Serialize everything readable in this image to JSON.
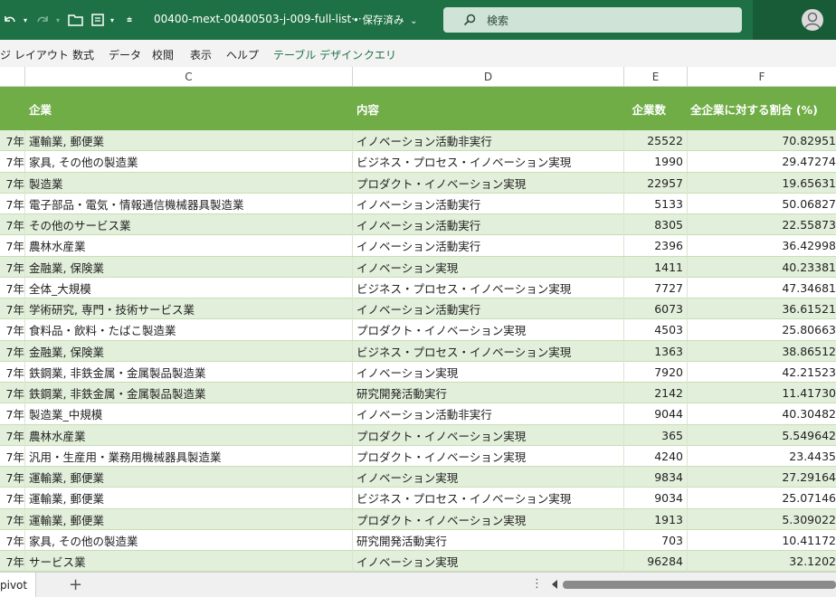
{
  "titlebar": {
    "document_name": "00400-mext-00400503-j-009-full-list···",
    "save_status": "• 保存済み",
    "search_placeholder": "検索"
  },
  "ribbon": {
    "tabs": [
      "ジ レイアウト",
      "数式",
      "データ",
      "校閲",
      "表示",
      "ヘルプ",
      "テーブル デザイン",
      "クエリ"
    ]
  },
  "columns": [
    "C",
    "D",
    "E",
    "F"
  ],
  "table": {
    "headers": {
      "company": "企業",
      "content": "内容",
      "count": "企業数",
      "ratio": "全企業に対する割合 (%)"
    },
    "rows": [
      {
        "year": "7年",
        "company": "運輸業, 郵便業",
        "content": "イノベーション活動非実行",
        "count": "25522",
        "ratio": "70.82951"
      },
      {
        "year": "7年",
        "company": "家具, その他の製造業",
        "content": "ビジネス・プロセス・イノベーション実現",
        "count": "1990",
        "ratio": "29.47274"
      },
      {
        "year": "7年",
        "company": "製造業",
        "content": "プロダクト・イノベーション実現",
        "count": "22957",
        "ratio": "19.65631"
      },
      {
        "year": "7年",
        "company": "電子部品・電気・情報通信機械器具製造業",
        "content": "イノベーション活動実行",
        "count": "5133",
        "ratio": "50.06827"
      },
      {
        "year": "7年",
        "company": "その他のサービス業",
        "content": "イノベーション活動実行",
        "count": "8305",
        "ratio": "22.55873"
      },
      {
        "year": "7年",
        "company": "農林水産業",
        "content": "イノベーション活動実行",
        "count": "2396",
        "ratio": "36.42998"
      },
      {
        "year": "7年",
        "company": "金融業, 保険業",
        "content": "イノベーション実現",
        "count": "1411",
        "ratio": "40.23381"
      },
      {
        "year": "7年",
        "company": "全体_大規模",
        "content": "ビジネス・プロセス・イノベーション実現",
        "count": "7727",
        "ratio": "47.34681"
      },
      {
        "year": "7年",
        "company": "学術研究, 専門・技術サービス業",
        "content": "イノベーション活動実行",
        "count": "6073",
        "ratio": "36.61521"
      },
      {
        "year": "7年",
        "company": "食料品・飲料・たばこ製造業",
        "content": "プロダクト・イノベーション実現",
        "count": "4503",
        "ratio": "25.80663"
      },
      {
        "year": "7年",
        "company": "金融業, 保険業",
        "content": "ビジネス・プロセス・イノベーション実現",
        "count": "1363",
        "ratio": "38.86512"
      },
      {
        "year": "7年",
        "company": "鉄鋼業, 非鉄金属・金属製品製造業",
        "content": "イノベーション実現",
        "count": "7920",
        "ratio": "42.21523"
      },
      {
        "year": "7年",
        "company": "鉄鋼業, 非鉄金属・金属製品製造業",
        "content": "研究開発活動実行",
        "count": "2142",
        "ratio": "11.41730"
      },
      {
        "year": "7年",
        "company": "製造業_中規模",
        "content": "イノベーション活動非実行",
        "count": "9044",
        "ratio": "40.30482"
      },
      {
        "year": "7年",
        "company": "農林水産業",
        "content": "プロダクト・イノベーション実現",
        "count": "365",
        "ratio": "5.549642"
      },
      {
        "year": "7年",
        "company": "汎用・生産用・業務用機械器具製造業",
        "content": "プロダクト・イノベーション実現",
        "count": "4240",
        "ratio": "23.4435"
      },
      {
        "year": "7年",
        "company": "運輸業, 郵便業",
        "content": "イノベーション実現",
        "count": "9834",
        "ratio": "27.29164"
      },
      {
        "year": "7年",
        "company": "運輸業, 郵便業",
        "content": "ビジネス・プロセス・イノベーション実現",
        "count": "9034",
        "ratio": "25.07146"
      },
      {
        "year": "7年",
        "company": "運輸業, 郵便業",
        "content": "プロダクト・イノベーション実現",
        "count": "1913",
        "ratio": "5.309022"
      },
      {
        "year": "7年",
        "company": "家具, その他の製造業",
        "content": "研究開発活動実行",
        "count": "703",
        "ratio": "10.41172"
      },
      {
        "year": "7年",
        "company": "サービス業",
        "content": "イノベーション実現",
        "count": "96284",
        "ratio": "32.1202"
      }
    ]
  },
  "sheets": {
    "active_tab": "pivot",
    "add_label": "+"
  },
  "colors": {
    "titlebar": "#1e7145",
    "table_header": "#70ad47",
    "band_row": "#e2efda"
  }
}
